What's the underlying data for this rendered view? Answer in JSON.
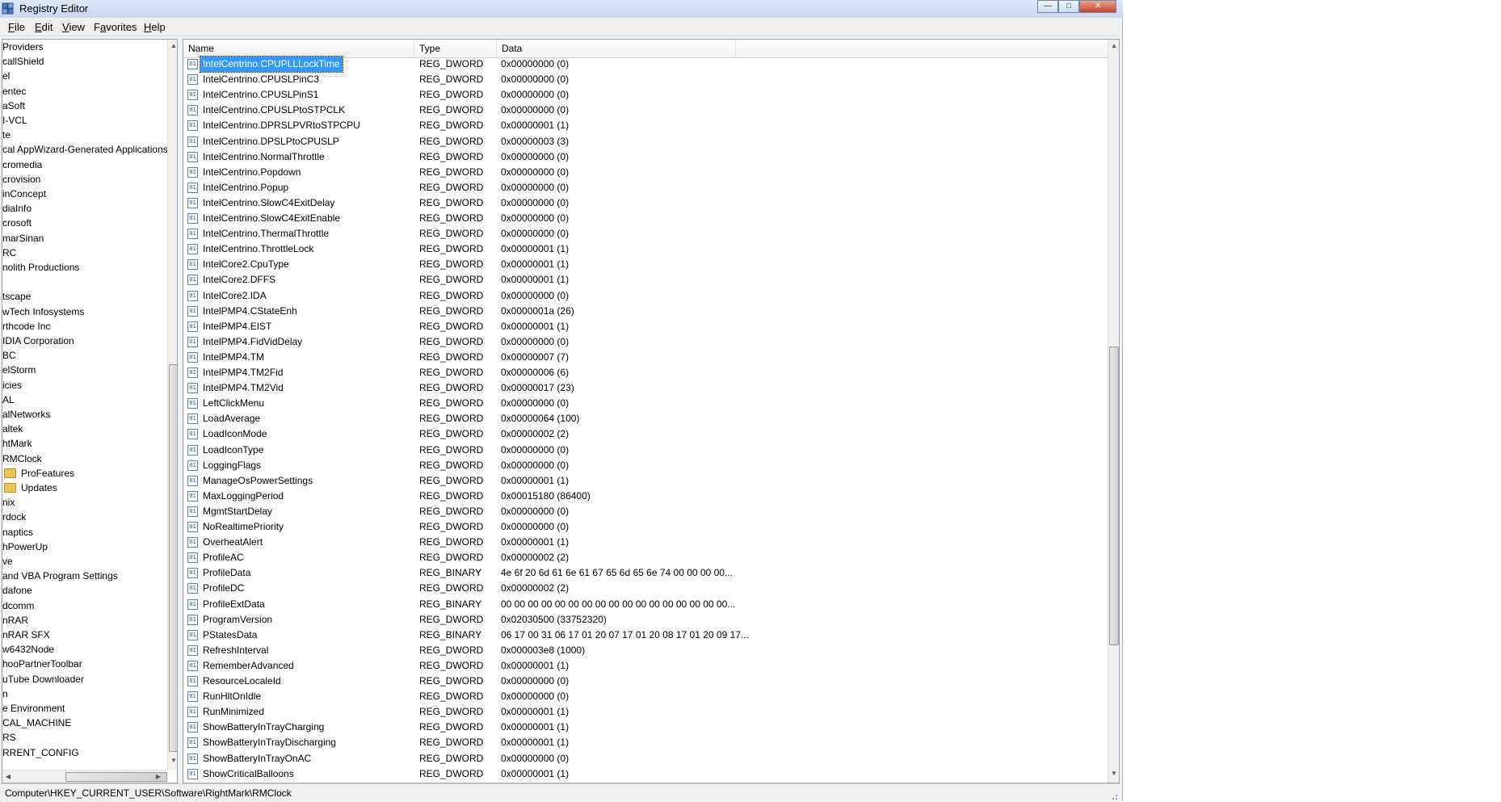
{
  "window": {
    "title": "Registry Editor"
  },
  "menu": [
    {
      "acc": "F",
      "rest": "ile"
    },
    {
      "acc": "E",
      "rest": "dit"
    },
    {
      "acc": "V",
      "rest": "iew"
    },
    {
      "pre": "F",
      "acc": "a",
      "rest": "vorites"
    },
    {
      "acc": "H",
      "rest": "elp"
    }
  ],
  "tree": [
    {
      "label": "Providers"
    },
    {
      "label": "callShield"
    },
    {
      "label": "el"
    },
    {
      "label": "entec"
    },
    {
      "label": "aSoft"
    },
    {
      "label": "I-VCL"
    },
    {
      "label": "te"
    },
    {
      "label": "cal AppWizard-Generated Applications"
    },
    {
      "label": "cromedia"
    },
    {
      "label": "crovision"
    },
    {
      "label": "inConcept"
    },
    {
      "label": "diaInfo"
    },
    {
      "label": "crosoft"
    },
    {
      "label": "marSinan"
    },
    {
      "label": "RC"
    },
    {
      "label": "nolith Productions"
    },
    {
      "label": ""
    },
    {
      "label": "tscape"
    },
    {
      "label": "wTech Infosystems"
    },
    {
      "label": "rthcode Inc"
    },
    {
      "label": "IDIA Corporation"
    },
    {
      "label": "BC"
    },
    {
      "label": "elStorm"
    },
    {
      "label": "icies"
    },
    {
      "label": "AL"
    },
    {
      "label": "alNetworks"
    },
    {
      "label": "altek"
    },
    {
      "label": "htMark"
    },
    {
      "label": "RMClock"
    },
    {
      "label": "ProFeatures",
      "folder": true
    },
    {
      "label": "Updates",
      "folder": true
    },
    {
      "label": "nix"
    },
    {
      "label": "rdock"
    },
    {
      "label": "naptics"
    },
    {
      "label": "hPowerUp"
    },
    {
      "label": "ve"
    },
    {
      "label": "and VBA Program Settings"
    },
    {
      "label": "dafone"
    },
    {
      "label": "dcomm"
    },
    {
      "label": "nRAR"
    },
    {
      "label": "nRAR SFX"
    },
    {
      "label": "w6432Node"
    },
    {
      "label": "hooPartnerToolbar"
    },
    {
      "label": "uTube Downloader"
    },
    {
      "label": "n"
    },
    {
      "label": "e Environment"
    },
    {
      "label": "CAL_MACHINE"
    },
    {
      "label": "RS"
    },
    {
      "label": "RRENT_CONFIG"
    }
  ],
  "columns": [
    "Name",
    "Type",
    "Data"
  ],
  "values": [
    {
      "name": "IntelCentrino.CPUPLLLockTime",
      "type": "REG_DWORD",
      "data": "0x00000000 (0)",
      "selected": true
    },
    {
      "name": "IntelCentrino.CPUSLPinC3",
      "type": "REG_DWORD",
      "data": "0x00000000 (0)"
    },
    {
      "name": "IntelCentrino.CPUSLPinS1",
      "type": "REG_DWORD",
      "data": "0x00000000 (0)"
    },
    {
      "name": "IntelCentrino.CPUSLPtoSTPCLK",
      "type": "REG_DWORD",
      "data": "0x00000000 (0)"
    },
    {
      "name": "IntelCentrino.DPRSLPVRtoSTPCPU",
      "type": "REG_DWORD",
      "data": "0x00000001 (1)"
    },
    {
      "name": "IntelCentrino.DPSLPtoCPUSLP",
      "type": "REG_DWORD",
      "data": "0x00000003 (3)"
    },
    {
      "name": "IntelCentrino.NormalThrottle",
      "type": "REG_DWORD",
      "data": "0x00000000 (0)"
    },
    {
      "name": "IntelCentrino.Popdown",
      "type": "REG_DWORD",
      "data": "0x00000000 (0)"
    },
    {
      "name": "IntelCentrino.Popup",
      "type": "REG_DWORD",
      "data": "0x00000000 (0)"
    },
    {
      "name": "IntelCentrino.SlowC4ExitDelay",
      "type": "REG_DWORD",
      "data": "0x00000000 (0)"
    },
    {
      "name": "IntelCentrino.SlowC4ExitEnable",
      "type": "REG_DWORD",
      "data": "0x00000000 (0)"
    },
    {
      "name": "IntelCentrino.ThermalThrottle",
      "type": "REG_DWORD",
      "data": "0x00000000 (0)"
    },
    {
      "name": "IntelCentrino.ThrottleLock",
      "type": "REG_DWORD",
      "data": "0x00000001 (1)"
    },
    {
      "name": "IntelCore2.CpuType",
      "type": "REG_DWORD",
      "data": "0x00000001 (1)"
    },
    {
      "name": "IntelCore2.DFFS",
      "type": "REG_DWORD",
      "data": "0x00000001 (1)"
    },
    {
      "name": "IntelCore2.IDA",
      "type": "REG_DWORD",
      "data": "0x00000000 (0)"
    },
    {
      "name": "IntelPMP4.CStateEnh",
      "type": "REG_DWORD",
      "data": "0x0000001a (26)"
    },
    {
      "name": "IntelPMP4.EIST",
      "type": "REG_DWORD",
      "data": "0x00000001 (1)"
    },
    {
      "name": "IntelPMP4.FidVidDelay",
      "type": "REG_DWORD",
      "data": "0x00000000 (0)"
    },
    {
      "name": "IntelPMP4.TM",
      "type": "REG_DWORD",
      "data": "0x00000007 (7)"
    },
    {
      "name": "IntelPMP4.TM2Fid",
      "type": "REG_DWORD",
      "data": "0x00000006 (6)"
    },
    {
      "name": "IntelPMP4.TM2Vid",
      "type": "REG_DWORD",
      "data": "0x00000017 (23)"
    },
    {
      "name": "LeftClickMenu",
      "type": "REG_DWORD",
      "data": "0x00000000 (0)"
    },
    {
      "name": "LoadAverage",
      "type": "REG_DWORD",
      "data": "0x00000064 (100)"
    },
    {
      "name": "LoadIconMode",
      "type": "REG_DWORD",
      "data": "0x00000002 (2)"
    },
    {
      "name": "LoadIconType",
      "type": "REG_DWORD",
      "data": "0x00000000 (0)"
    },
    {
      "name": "LoggingFlags",
      "type": "REG_DWORD",
      "data": "0x00000000 (0)"
    },
    {
      "name": "ManageOsPowerSettings",
      "type": "REG_DWORD",
      "data": "0x00000001 (1)"
    },
    {
      "name": "MaxLoggingPeriod",
      "type": "REG_DWORD",
      "data": "0x00015180 (86400)"
    },
    {
      "name": "MgmtStartDelay",
      "type": "REG_DWORD",
      "data": "0x00000000 (0)"
    },
    {
      "name": "NoRealtimePriority",
      "type": "REG_DWORD",
      "data": "0x00000000 (0)"
    },
    {
      "name": "OverheatAlert",
      "type": "REG_DWORD",
      "data": "0x00000001 (1)"
    },
    {
      "name": "ProfileAC",
      "type": "REG_DWORD",
      "data": "0x00000002 (2)"
    },
    {
      "name": "ProfileData",
      "type": "REG_BINARY",
      "data": "4e 6f 20 6d 61 6e 61 67 65 6d 65 6e 74 00 00 00 00..."
    },
    {
      "name": "ProfileDC",
      "type": "REG_DWORD",
      "data": "0x00000002 (2)"
    },
    {
      "name": "ProfileExtData",
      "type": "REG_BINARY",
      "data": "00 00 00 00 00 00 00 00 00 00 00 00 00 00 00 00 00..."
    },
    {
      "name": "ProgramVersion",
      "type": "REG_DWORD",
      "data": "0x02030500 (33752320)"
    },
    {
      "name": "PStatesData",
      "type": "REG_BINARY",
      "data": "06 17 00 31 06 17 01 20 07 17 01 20 08 17 01 20 09 17..."
    },
    {
      "name": "RefreshInterval",
      "type": "REG_DWORD",
      "data": "0x000003e8 (1000)"
    },
    {
      "name": "RememberAdvanced",
      "type": "REG_DWORD",
      "data": "0x00000001 (1)"
    },
    {
      "name": "ResourceLocaleId",
      "type": "REG_DWORD",
      "data": "0x00000000 (0)"
    },
    {
      "name": "RunHltOnIdle",
      "type": "REG_DWORD",
      "data": "0x00000000 (0)"
    },
    {
      "name": "RunMinimized",
      "type": "REG_DWORD",
      "data": "0x00000001 (1)"
    },
    {
      "name": "ShowBatteryInTrayCharging",
      "type": "REG_DWORD",
      "data": "0x00000001 (1)"
    },
    {
      "name": "ShowBatteryInTrayDischarging",
      "type": "REG_DWORD",
      "data": "0x00000001 (1)"
    },
    {
      "name": "ShowBatteryInTrayOnAC",
      "type": "REG_DWORD",
      "data": "0x00000000 (0)"
    },
    {
      "name": "ShowCriticalBalloons",
      "type": "REG_DWORD",
      "data": "0x00000001 (1)"
    }
  ],
  "status": {
    "path": "Computer\\HKEY_CURRENT_USER\\Software\\RightMark\\RMClock"
  },
  "icons": {
    "app": "registry-editor-icon",
    "minimize": "minimize-icon",
    "maximize": "maximize-icon",
    "close": "close-icon",
    "folder": "folder-icon",
    "value": "reg-dword-icon"
  },
  "colors": {
    "selection": "#3399ff",
    "titlebar": "#c9d9ee",
    "folder": "#e8c45a"
  }
}
